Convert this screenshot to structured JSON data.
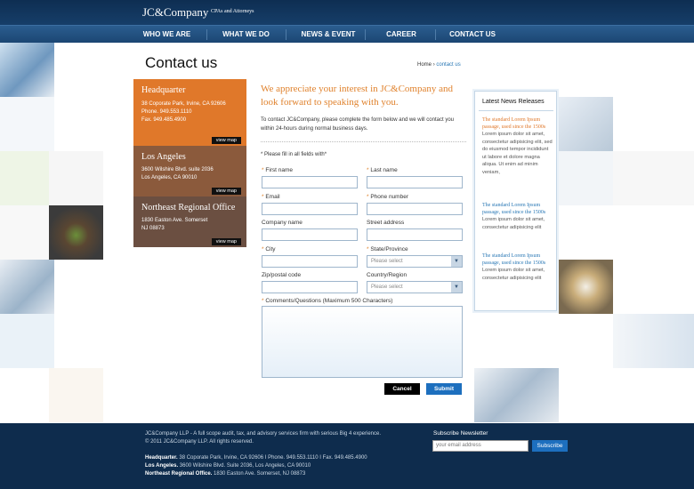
{
  "header": {
    "logo": "JC&Company",
    "tagline": "CPAs and Attorneys"
  },
  "nav": [
    "WHO WE ARE",
    "WHAT WE DO",
    "NEWS & EVENT",
    "CAREER",
    "CONTACT US"
  ],
  "page": {
    "title": "Contact us",
    "breadcrumb_home": "Home",
    "breadcrumb_sep": "›",
    "breadcrumb_current": "contact us"
  },
  "locations": [
    {
      "name": "Headquarter",
      "lines": [
        "38 Coporate Park, Irvine, CA 92606",
        "Phone. 949.553.1110",
        "Fax. 949.485.4900"
      ],
      "map": "view map",
      "color": "#e0782a"
    },
    {
      "name": "Los Angeles",
      "lines": [
        "3600 Wilshire Blvd. suite 2036",
        "Los Angeles, CA 90010"
      ],
      "map": "view map",
      "color": "#8b5a3c"
    },
    {
      "name": "Northeast Regional Office",
      "lines": [
        "1830 Easton Ave. Somerset",
        "NJ 08873"
      ],
      "map": "view map",
      "color": "#6b4f41"
    }
  ],
  "intro": {
    "heading": "We appreciate your interest in JC&Company and look forward to speaking with you.",
    "text": "To contact JC&Company, please complete the form below and we will contact you within 24-hours during normal business days."
  },
  "form": {
    "required_note": "* Please fill in all fields with*",
    "first_name": "First name",
    "last_name": "Last name",
    "email": "Email",
    "phone": "Phone number",
    "company": "Company name",
    "street": "Street address",
    "city": "City",
    "state": "State/Province",
    "zip": "Zip/postal code",
    "country": "Country/Region",
    "select_placeholder": "Please select",
    "comments": "Comments/Questions (Maximum 500 Characters)",
    "cancel": "Cancel",
    "submit": "Submit"
  },
  "news": {
    "title": "Latest News Releases",
    "items": [
      {
        "title": "The standard Lorem Ipsum passage, used since the 1500s",
        "body": "Lorem ipsum dolor sit amet, consectetur adipisicing elit, sed do eiusmod tempor incididunt ut labore et dolore magna aliqua. Ut enim ad minim veniam,",
        "color": "#e0782a"
      },
      {
        "title": "The standard Lorem Ipsum passage, used since the 1500s",
        "body": "Lorem ipsum dolor sit amet, consectetur adipisicing elit",
        "color": "#2a78b5"
      },
      {
        "title": "The standard Lorem Ipsum passage, used since the 1500s",
        "body": "Lorem ipsum dolor sit amet, consectetur adipisicing elit",
        "color": "#2a78b5"
      }
    ]
  },
  "footer": {
    "line1": "JC&Company LLP - A full scope audit, tax, and advisory services firm with serious Big 4 experience.",
    "line2": "© 2011 JC&Company LLP.  All rights reserved.",
    "hq_label": "Headquarter.",
    "hq_text": "38 Coporate Park, Irvine, CA 92606  I  Phone. 949.553.1110  I  Fax. 949.485.4900",
    "la_label": "Los Angeles.",
    "la_text": "3600 Wilshire Blvd. Suite 2036, Los Angeles, CA 90010",
    "ne_label": "Northeast Regional Office.",
    "ne_text": "1830 Easton Ave. Somerset, NJ 08873",
    "subscribe_label": "Subscribe Newsletter",
    "subscribe_placeholder": "your email address",
    "subscribe_button": "Subscribe"
  },
  "colors": {
    "accent": "#e0822d",
    "brand": "#163e69",
    "link": "#2a78b5"
  }
}
